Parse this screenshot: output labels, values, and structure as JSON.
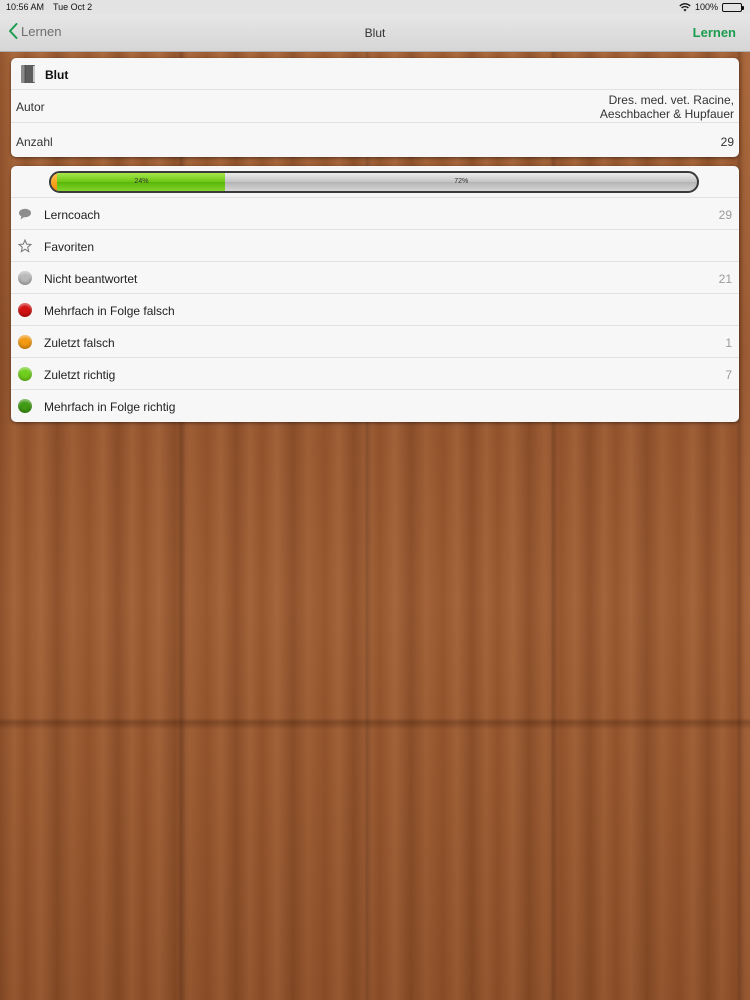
{
  "status_bar": {
    "time": "10:56 AM",
    "date": "Tue Oct 2",
    "battery": "100%"
  },
  "nav": {
    "back_label": "Lernen",
    "title": "Blut",
    "action_label": "Lernen"
  },
  "info": {
    "title": "Blut",
    "author_label": "Autor",
    "author_line1": "Dres. med. vet. Racine,",
    "author_line2": "Aeschbacher & Hupfauer",
    "count_label": "Anzahl",
    "count_value": "29"
  },
  "progress": {
    "orange_fraction": 0.01,
    "green_fraction": 0.26,
    "green_label": "24%",
    "gray_label": "72%"
  },
  "items": [
    {
      "label": "Lerncoach",
      "count": "29",
      "icon": "speech-bubble-icon",
      "color": ""
    },
    {
      "label": "Favoriten",
      "count": "",
      "icon": "star-icon",
      "color": ""
    },
    {
      "label": "Nicht beantwortet",
      "count": "21",
      "icon": "gray-dot-icon",
      "color": "#b9b9b9"
    },
    {
      "label": "Mehrfach in Folge falsch",
      "count": "",
      "icon": "red-dot-icon",
      "color": "#d31212"
    },
    {
      "label": "Zuletzt falsch",
      "count": "1",
      "icon": "orange-dot-icon",
      "color": "#f39a12"
    },
    {
      "label": "Zuletzt richtig",
      "count": "7",
      "icon": "light-green-dot-icon",
      "color": "#6fcf1c"
    },
    {
      "label": "Mehrfach in Folge richtig",
      "count": "",
      "icon": "dark-green-dot-icon",
      "color": "#3f9a14"
    }
  ],
  "colors": {
    "accent": "#1c9c4f",
    "back": "#6e6e6e"
  }
}
